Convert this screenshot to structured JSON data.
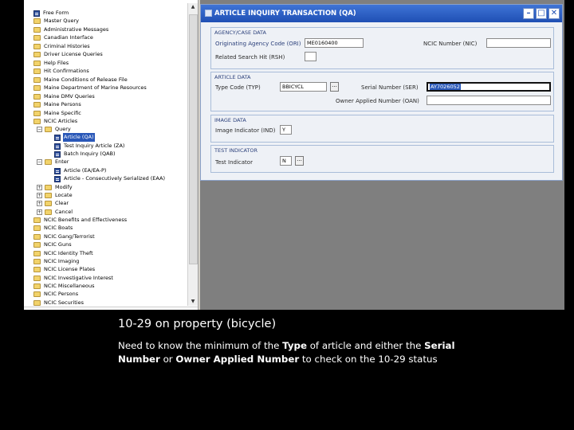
{
  "tree": {
    "items": [
      {
        "label": "Free Form",
        "type": "doc"
      },
      {
        "label": "Master Query",
        "type": "folder"
      },
      {
        "label": "Administrative Messages",
        "type": "folder"
      },
      {
        "label": "Canadian Interface",
        "type": "folder"
      },
      {
        "label": "Criminal Histories",
        "type": "folder"
      },
      {
        "label": "Driver License Queries",
        "type": "folder"
      },
      {
        "label": "Help Files",
        "type": "folder"
      },
      {
        "label": "Hit Confirmations",
        "type": "folder"
      },
      {
        "label": "Maine Conditions of Release File",
        "type": "folder"
      },
      {
        "label": "Maine Department of Marine Resources",
        "type": "folder"
      },
      {
        "label": "Maine DMV Queries",
        "type": "folder"
      },
      {
        "label": "Maine Persons",
        "type": "folder"
      },
      {
        "label": "Maine Specific",
        "type": "folder"
      },
      {
        "label": "NCIC Articles",
        "type": "folder"
      },
      {
        "label": "Query",
        "type": "folder"
      },
      {
        "label": "Article (QA)",
        "type": "doc"
      },
      {
        "label": "Test Inquiry Article (ZA)",
        "type": "doc"
      },
      {
        "label": "Batch Inquiry (QAB)",
        "type": "doc"
      },
      {
        "label": "Enter",
        "type": "folder"
      },
      {
        "label": "Article (EA/EA-P)",
        "type": "doc"
      },
      {
        "label": "Article - Consecutively Serialized (EAA)",
        "type": "doc"
      },
      {
        "label": "Modify",
        "type": "folder"
      },
      {
        "label": "Locate",
        "type": "folder"
      },
      {
        "label": "Clear",
        "type": "folder"
      },
      {
        "label": "Cancel",
        "type": "folder"
      },
      {
        "label": "NCIC Benefits and Effectiveness",
        "type": "folder"
      },
      {
        "label": "NCIC Boats",
        "type": "folder"
      },
      {
        "label": "NCIC Gang/Terrorist",
        "type": "folder"
      },
      {
        "label": "NCIC Guns",
        "type": "folder"
      },
      {
        "label": "NCIC Identity Theft",
        "type": "folder"
      },
      {
        "label": "NCIC Imaging",
        "type": "folder"
      },
      {
        "label": "NCIC License Plates",
        "type": "folder"
      },
      {
        "label": "NCIC Investigative Interest",
        "type": "folder"
      },
      {
        "label": "NCIC Miscellaneous",
        "type": "folder"
      },
      {
        "label": "NCIC Persons",
        "type": "folder"
      },
      {
        "label": "NCIC Securities",
        "type": "folder"
      }
    ]
  },
  "window": {
    "title": "ARTICLE INQUIRY TRANSACTION (QA)",
    "btn_min": "–",
    "btn_max": "□",
    "btn_close": "✕"
  },
  "agency": {
    "title": "AGENCY/CASE DATA",
    "ori_label": "Originating Agency Code (ORI)",
    "ori_value": "ME0160400",
    "nic_label": "NCIC Number (NIC)",
    "nic_value": "",
    "rsh_label": "Related Search Hit (RSH)",
    "rsh_value": ""
  },
  "article": {
    "title": "ARTICLE DATA",
    "typ_label": "Type Code (TYP)",
    "typ_value": "BBICYCL",
    "ser_label": "Serial Number (SER)",
    "ser_value": "AY7026052",
    "oan_label": "Owner Applied Number (OAN)",
    "oan_value": "",
    "ellipsis": "..."
  },
  "image": {
    "title": "IMAGE DATA",
    "ind_label": "Image Indicator (IND)",
    "ind_value": "Y"
  },
  "test": {
    "title": "TEST INDICATOR",
    "label": "Test Indicator",
    "value": "N",
    "ellipsis": "..."
  },
  "caption": {
    "title": "10-29 on property (bicycle)",
    "body_1": "Need to  know the minimum of the ",
    "body_bold_1": "Type",
    "body_2": " of article and either the ",
    "body_bold_2": "Serial Number",
    "body_3": " or ",
    "body_bold_3": "Owner Applied Number",
    "body_4": " to check on the 10-29 status"
  },
  "colors": {
    "titlebar": "#1f4fb4",
    "selection": "#2a58b8",
    "background": "#000000"
  }
}
